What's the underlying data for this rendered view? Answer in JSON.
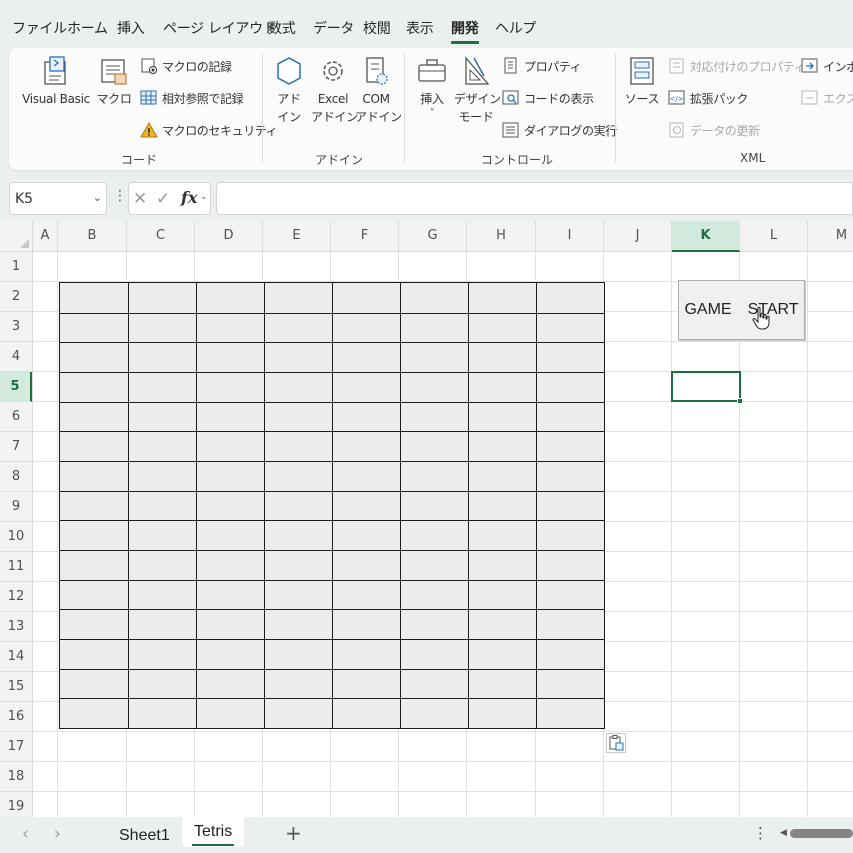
{
  "menu": {
    "tabs": [
      "ファイル",
      "ホーム",
      "挿入",
      "ページ レイアウト",
      "数式",
      "データ",
      "校閲",
      "表示",
      "開発",
      "ヘルプ"
    ],
    "active": "開発"
  },
  "ribbon": {
    "code": {
      "label": "コード",
      "visual_basic": "Visual Basic",
      "macro": "マクロ",
      "record_macro": "マクロの記録",
      "relative_refs": "相対参照で記録",
      "macro_security": "マクロのセキュリティ"
    },
    "addins": {
      "label": "アドイン",
      "addin_line1": "アド",
      "addin_line2": "イン",
      "excel_line1": "Excel",
      "excel_line2": "アドイン",
      "com_line1": "COM",
      "com_line2": "アドイン"
    },
    "controls": {
      "label": "コントロール",
      "insert": "挿入",
      "insert_arrow": "˅",
      "design_line1": "デザイン",
      "design_line2": "モード",
      "properties": "プロパティ",
      "view_code": "コードの表示",
      "run_dialog": "ダイアログの実行"
    },
    "xml": {
      "label": "XML",
      "source": "ソース",
      "map_properties": "対応付けのプロパティ",
      "expansion_packs": "拡張パック",
      "refresh_data": "データの更新",
      "import": "インポート",
      "export": "エクスポート"
    }
  },
  "formula_bar": {
    "name_box": "K5",
    "fx": "fx",
    "formula": ""
  },
  "grid": {
    "columns": [
      "A",
      "B",
      "C",
      "D",
      "E",
      "F",
      "G",
      "H",
      "I",
      "J",
      "K",
      "L",
      "M"
    ],
    "rows": [
      "1",
      "2",
      "3",
      "4",
      "5",
      "6",
      "7",
      "8",
      "9",
      "10",
      "11",
      "12",
      "13",
      "14",
      "15",
      "16",
      "17",
      "18",
      "19"
    ],
    "selected_cell": "K5",
    "board_range": "B2:I16",
    "board_fill": "#ececec"
  },
  "game_button": {
    "label": "GAME　START"
  },
  "sheets": {
    "tabs": [
      "Sheet1",
      "Tetris"
    ],
    "active": "Tetris",
    "add": "+",
    "more": "⋮"
  },
  "colors": {
    "accent": "#1e6e42",
    "header_bg": "#f3f3f3",
    "chrome_bg": "#e9f0ee"
  }
}
